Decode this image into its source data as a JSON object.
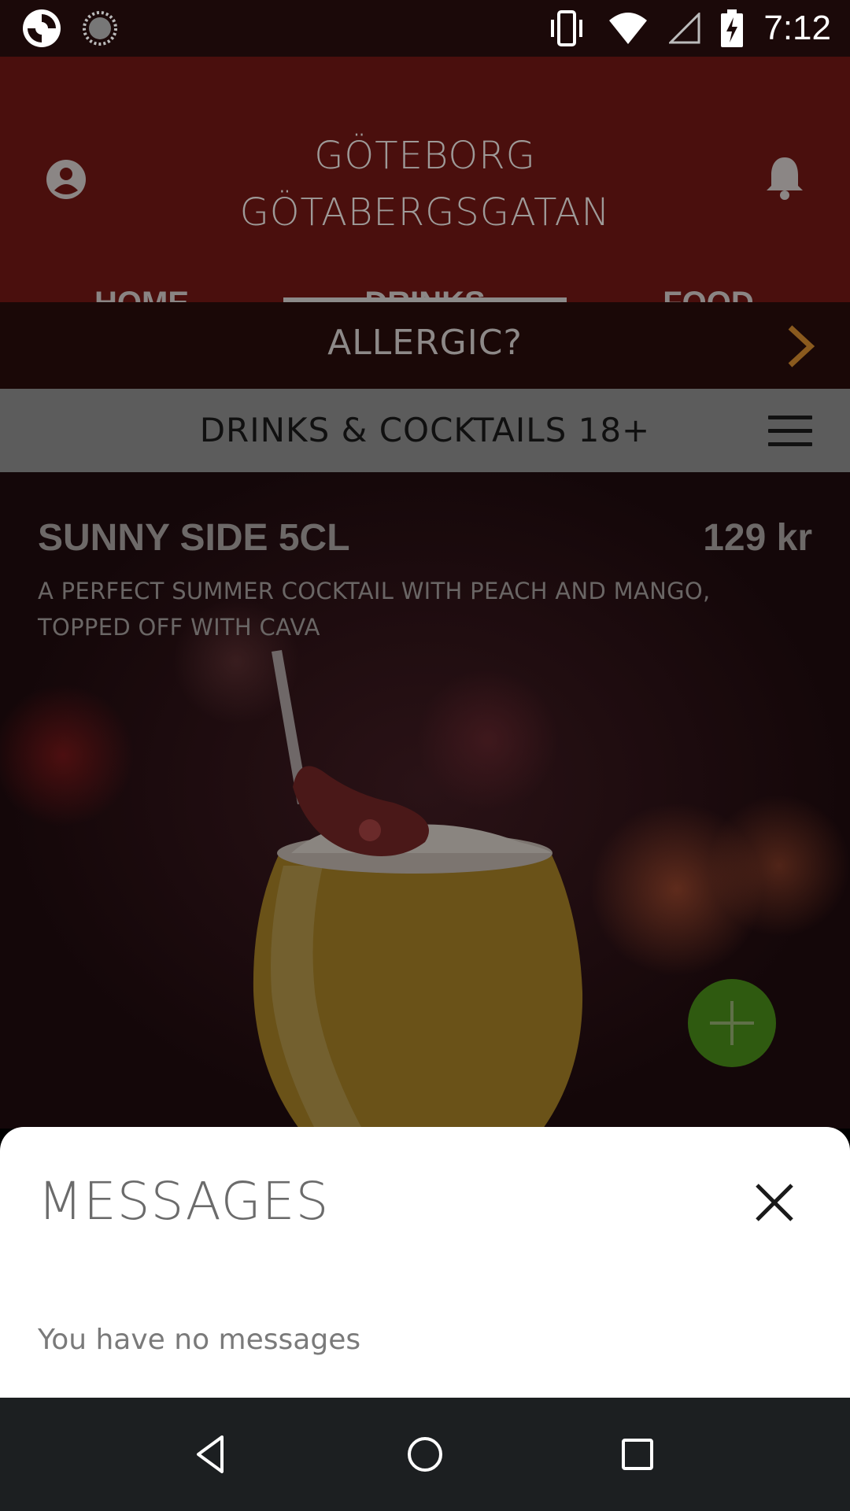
{
  "status_bar": {
    "time": "7:12",
    "icons": [
      "app-logo-icon",
      "sync-icon",
      "vibrate-icon",
      "wifi-icon",
      "cell-signal-icon",
      "battery-charging-icon"
    ]
  },
  "header": {
    "location_line1": "GÖTEBORG",
    "location_line2": "GÖTABERGSGATAN",
    "icons": [
      "profile-icon",
      "bell-icon"
    ]
  },
  "tabs": [
    {
      "label": "HOME",
      "active": false
    },
    {
      "label": "DRINKS",
      "active": true
    },
    {
      "label": "FOOD",
      "active": false
    }
  ],
  "allergic": {
    "label": "ALLERGIC?",
    "accent_color": "#8a5a1e"
  },
  "category": {
    "label": "DRINKS & COCKTAILS 18+"
  },
  "product": {
    "name": "SUNNY SIDE 5CL",
    "price": "129 kr",
    "description": "A PERFECT SUMMER COCKTAIL WITH PEACH AND MANGO, TOPPED OFF WITH CAVA",
    "add_button_color": "#2f5a10"
  },
  "messages": {
    "title": "MESSAGES",
    "empty_text": "You have no messages"
  },
  "nav": {
    "buttons": [
      "back",
      "home",
      "recents"
    ]
  }
}
